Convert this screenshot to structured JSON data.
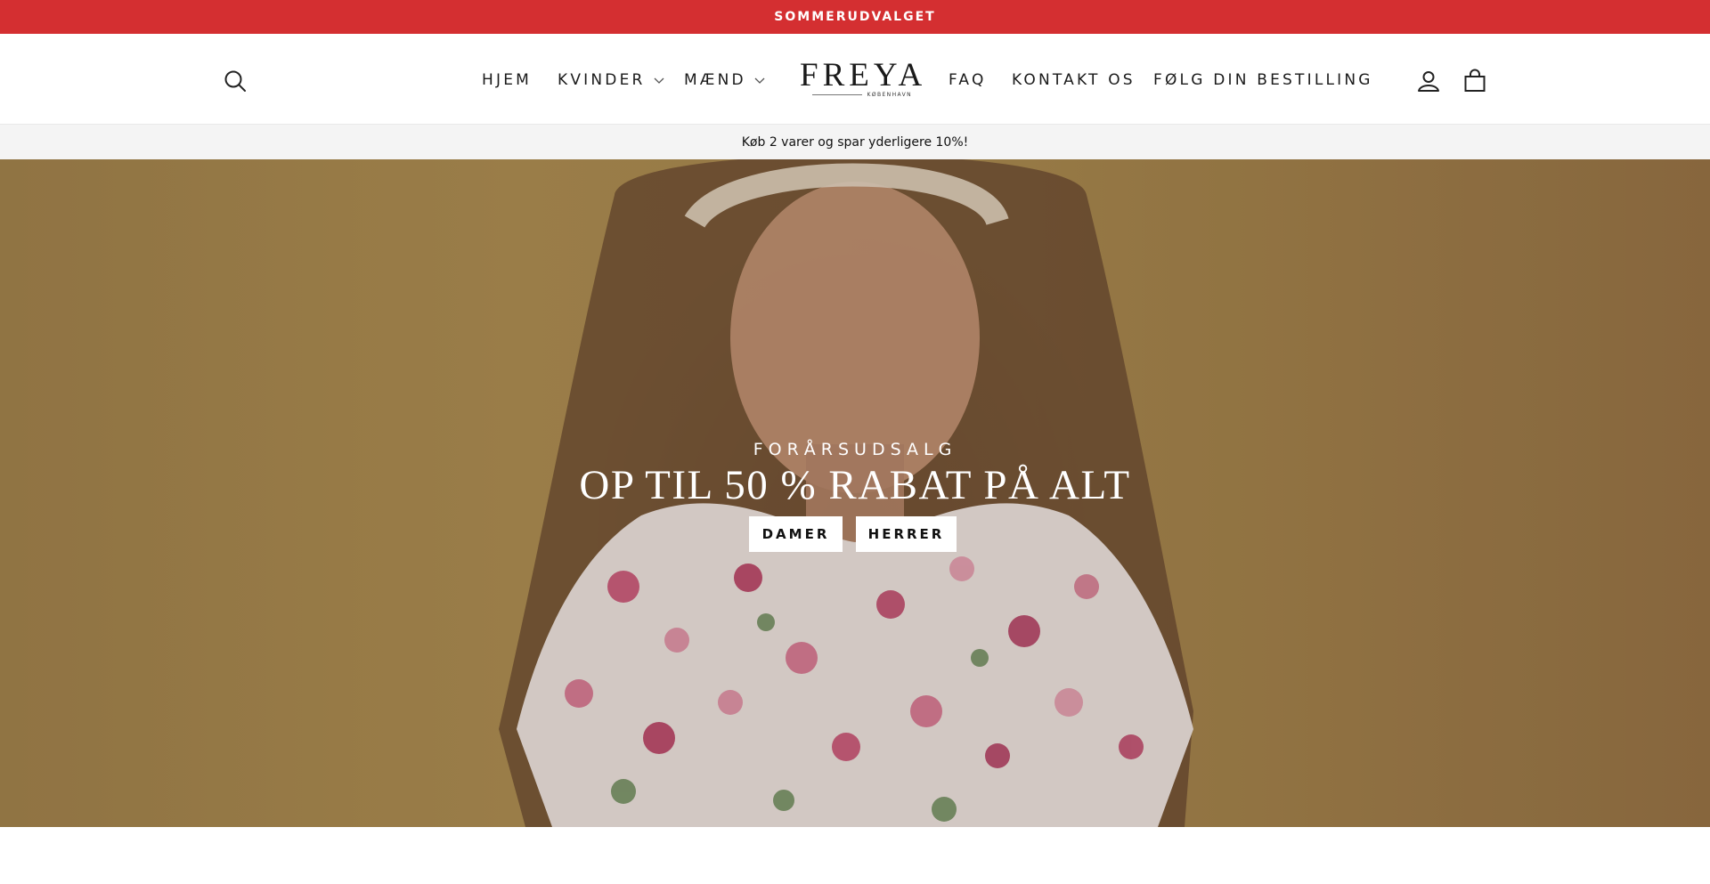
{
  "announcement": {
    "text": "SOMMERUDVALGET"
  },
  "header": {
    "nav_left": [
      {
        "label": "HJEM",
        "has_dropdown": false
      },
      {
        "label": "KVINDER",
        "has_dropdown": true
      },
      {
        "label": "MÆND",
        "has_dropdown": true
      }
    ],
    "logo": {
      "name": "FREYA",
      "sub": "KØBENHAVN"
    },
    "nav_right": [
      {
        "label": "FAQ"
      },
      {
        "label": "KONTAKT OS"
      },
      {
        "label": "FØLG DIN BESTILLING"
      }
    ],
    "icons": [
      "search-icon",
      "account-icon",
      "cart-icon"
    ]
  },
  "promo_bar": {
    "text": "Køb 2 varer og spar yderligere 10%!"
  },
  "hero": {
    "subtitle": "FORÅRSUDSALG",
    "title": "OP TIL 50 % RABAT PÅ ALT",
    "buttons": [
      {
        "label": "DAMER"
      },
      {
        "label": "HERRER"
      }
    ]
  },
  "colors": {
    "announcement_bg": "#d42f31",
    "promo_bg": "#f4f4f4",
    "hero_bg": "#ab8a4f",
    "text": "#1a1a1a"
  }
}
